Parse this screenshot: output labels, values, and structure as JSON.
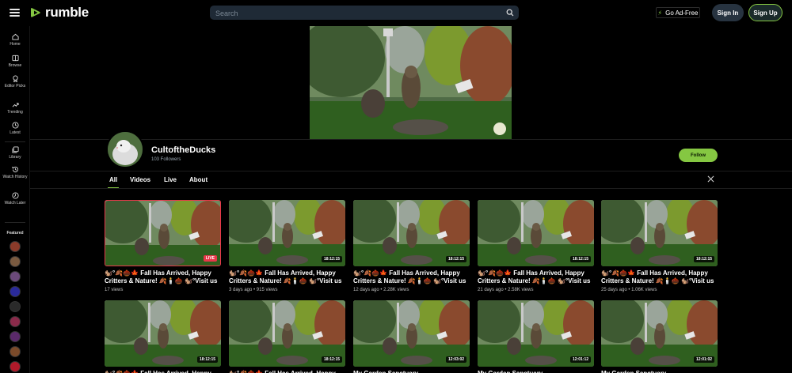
{
  "header": {
    "logo_text": "rumble",
    "search_placeholder": "Search",
    "adfree_label": "Go Ad-Free",
    "signin_label": "Sign In",
    "signup_label": "Sign Up"
  },
  "sidebar": {
    "items": [
      {
        "label": "Home",
        "icon": "home-icon"
      },
      {
        "label": "Browse",
        "icon": "browse-icon"
      },
      {
        "label": "Editor Picks",
        "icon": "editor-picks-icon"
      },
      {
        "label": "Trending",
        "icon": "trending-icon"
      },
      {
        "label": "Latest",
        "icon": "clock-icon"
      },
      {
        "label": "Library",
        "icon": "library-icon"
      },
      {
        "label": "Watch History",
        "icon": "history-icon"
      },
      {
        "label": "Watch Later",
        "icon": "watch-later-icon"
      }
    ],
    "featured_label": "Featured",
    "featured_colors": [
      "#8a3b2a",
      "#7a5a40",
      "#6b4a7a",
      "#2a2a9a",
      "#2a2a2a",
      "#8a2a4a",
      "#5a2a6a",
      "#7a4a2a",
      "#b01a2a"
    ]
  },
  "channel": {
    "name": "CultoftheDucks",
    "followers": "103 Followers",
    "follow_label": "Follow"
  },
  "tabs": [
    "All",
    "Videos",
    "Live",
    "About"
  ],
  "colors": {
    "accent": "#85c742",
    "live": "#e8374a"
  },
  "videos_row1": [
    {
      "line1": "🐿️°🍂🌰🍁 Fall Has Arrived, Happy",
      "line2": "Critters & Nature! 🍂🕯️🌰 🐿️°Visit us ...",
      "meta": "17 views",
      "badge": "LIVE"
    },
    {
      "line1": "🐿️°🍂🌰🍁 Fall Has Arrived, Happy",
      "line2": "Critters & Nature! 🍂🕯️🌰 🐿️°Visit us ...",
      "meta": "3 days ago • 915 views",
      "badge": "18:12:15"
    },
    {
      "line1": "🐿️°🍂🌰🍁 Fall Has Arrived, Happy",
      "line2": "Critters & Nature! 🍂🕯️🌰 🐿️°Visit us ...",
      "meta": "12 days ago • 2.28K views",
      "badge": "18:12:15"
    },
    {
      "line1": "🐿️°🍂🌰🍁 Fall Has Arrived, Happy",
      "line2": "Critters & Nature! 🍂🕯️🌰 🐿️°Visit us ...",
      "meta": "21 days ago • 2.58K views",
      "badge": "18:12:15"
    },
    {
      "line1": "🐿️°🍂🌰🍁 Fall Has Arrived, Happy",
      "line2": "Critters & Nature! 🍂🕯️🌰 🐿️°Visit us ...",
      "meta": "25 days ago • 1.06K views",
      "badge": "18:12:15"
    }
  ],
  "videos_row2": [
    {
      "line1": "🐿️°🍂🌰🍁 Fall Has Arrived, Happy",
      "badge": "18:12:15"
    },
    {
      "line1": "🐿️°🍂🌰🍁 Fall Has Arrived, Happy",
      "badge": "18:12:15"
    },
    {
      "line1": "My Garden Sanctuary",
      "badge": "12:03:02"
    },
    {
      "line1": "My Garden Sanctuary",
      "badge": "12:01:12"
    },
    {
      "line1": "My Garden Sanctuary",
      "badge": "12:01:02"
    }
  ]
}
